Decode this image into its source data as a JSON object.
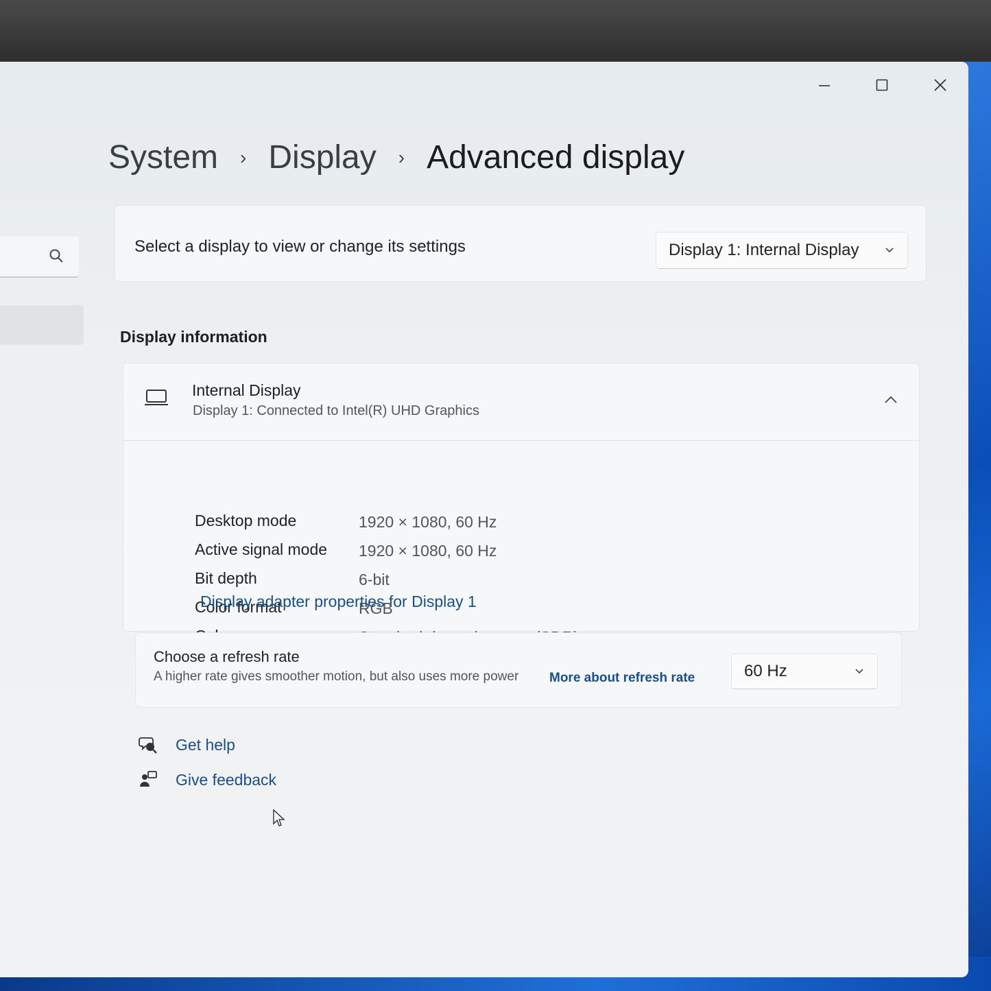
{
  "window": {
    "caption": {
      "minimize": "minimize",
      "maximize": "maximize",
      "close": "close"
    }
  },
  "breadcrumb": {
    "items": [
      "System",
      "Display",
      "Advanced display"
    ],
    "separator": "›"
  },
  "selector": {
    "label": "Select a display to view or change its settings",
    "selected": "Display 1: Internal Display"
  },
  "display_info": {
    "section_title": "Display information",
    "device_name": "Internal Display",
    "device_sub": "Display 1: Connected to Intel(R) UHD Graphics",
    "rows": [
      {
        "label": "Desktop mode",
        "value": "1920 × 1080, 60 Hz"
      },
      {
        "label": "Active signal mode",
        "value": "1920 × 1080, 60 Hz"
      },
      {
        "label": "Bit depth",
        "value": "6-bit"
      },
      {
        "label": "Color format",
        "value": "RGB"
      },
      {
        "label": "Color space",
        "value": "Standard dynamic range (SDR)"
      }
    ],
    "adapter_link": "Display adapter properties for Display 1"
  },
  "refresh": {
    "title": "Choose a refresh rate",
    "description": "A higher rate gives smoother motion, but also uses more power",
    "more_link": "More about refresh rate",
    "selected": "60 Hz"
  },
  "help": {
    "get_help": "Get help",
    "give_feedback": "Give feedback"
  },
  "colors": {
    "link": "#1a4f86",
    "card": "#f6f7f8",
    "window_bg": "#eef1f3",
    "wallpaper": "#1a6ad6"
  },
  "icons": [
    "search-icon",
    "minimize-icon",
    "maximize-icon",
    "close-icon",
    "chevron-right-icon",
    "chevron-down-icon",
    "chevron-up-icon",
    "laptop-icon",
    "help-icon",
    "feedback-icon",
    "cursor-icon"
  ]
}
